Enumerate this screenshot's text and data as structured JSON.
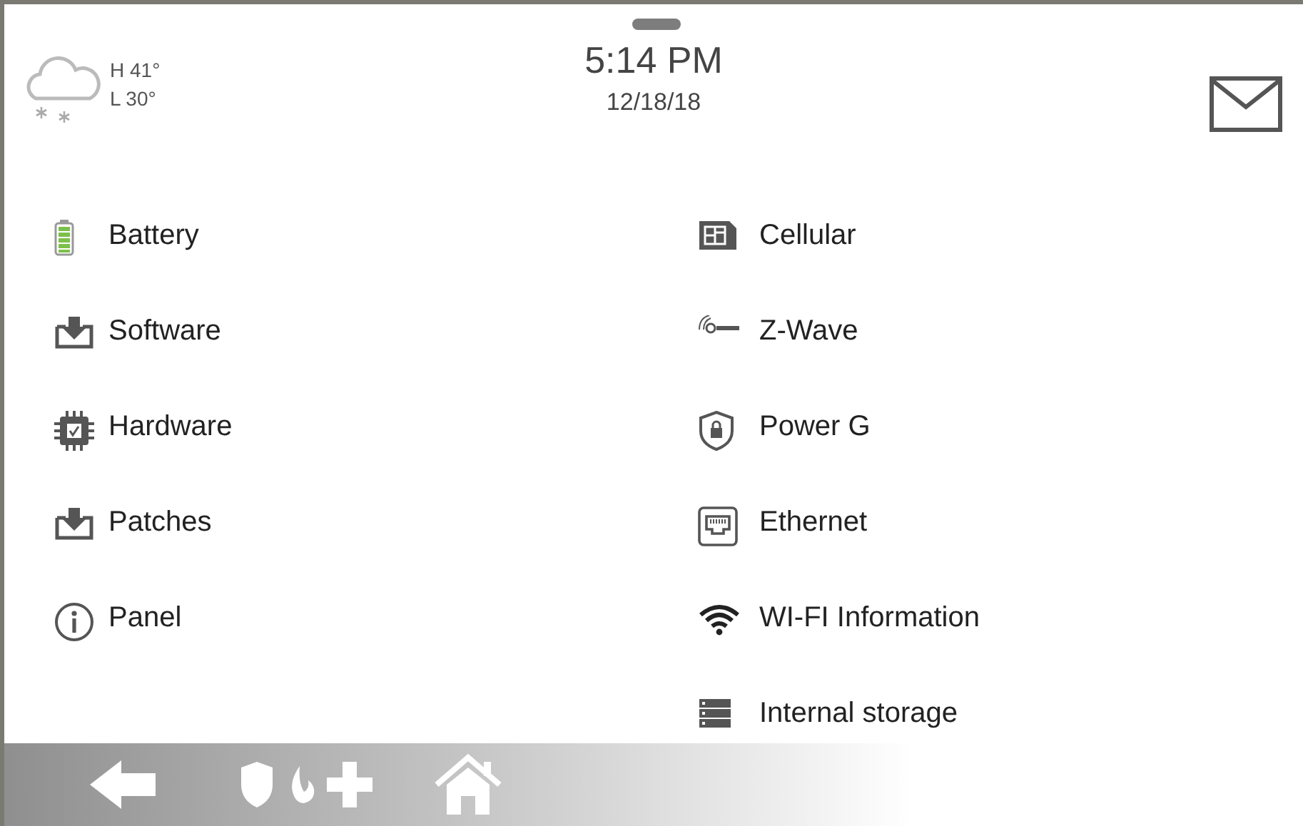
{
  "header": {
    "weather": {
      "high": "H 41°",
      "low": "L 30°"
    },
    "time": "5:14 PM",
    "date": "12/18/18"
  },
  "left_items": [
    {
      "label": "Battery",
      "kind": "battery"
    },
    {
      "label": "Software",
      "kind": "download"
    },
    {
      "label": "Hardware",
      "kind": "chip"
    },
    {
      "label": "Patches",
      "kind": "download"
    },
    {
      "label": "Panel",
      "kind": "info"
    }
  ],
  "right_items": [
    {
      "label": "Cellular",
      "kind": "sim"
    },
    {
      "label": "Z-Wave",
      "kind": "zwave"
    },
    {
      "label": "Power G",
      "kind": "shield"
    },
    {
      "label": "Ethernet",
      "kind": "ethernet"
    },
    {
      "label": "WI-FI Information",
      "kind": "wifi"
    },
    {
      "label": "Internal storage",
      "kind": "storage"
    }
  ]
}
